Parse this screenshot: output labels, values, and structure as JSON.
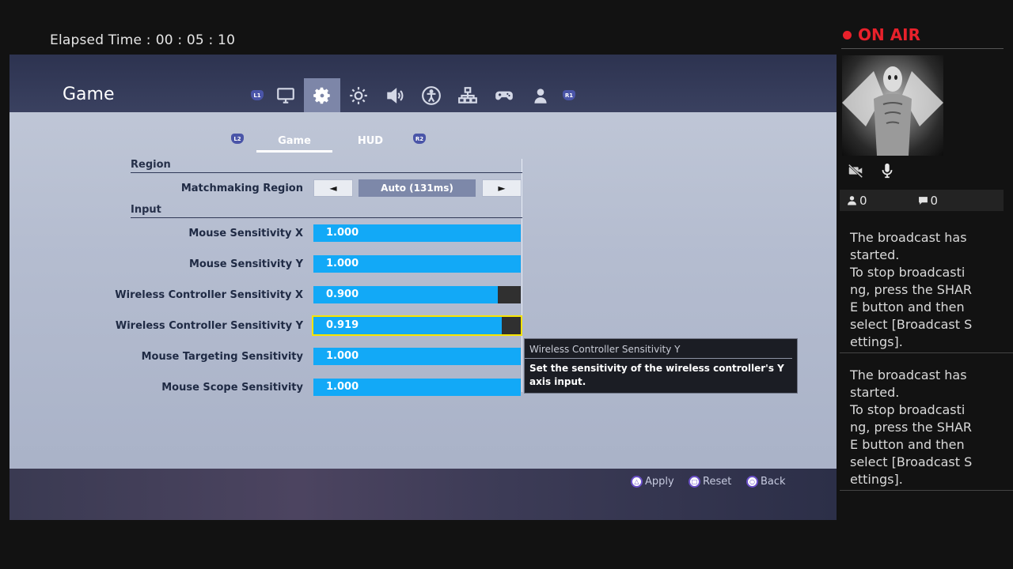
{
  "stream": {
    "elapsed_label": "Elapsed Time :",
    "elapsed_value": "00 : 05 : 10",
    "on_air": "ON AIR",
    "viewers": "0",
    "comments": "0",
    "messages": [
      "The broadcast has started.\nTo stop broadcasti ng, press the SHAR E button and then select [Broadcast S ettings].",
      "The broadcast has started.\nTo stop broadcasti ng, press the SHAR E button and then select [Broadcast S ettings]."
    ]
  },
  "game": {
    "title": "Game",
    "shoulder_left": "L1",
    "shoulder_right": "R1",
    "tab_icons": [
      "monitor-icon",
      "gear-icon",
      "brightness-icon",
      "audio-icon",
      "accessibility-icon",
      "network-icon",
      "controller-icon",
      "account-icon"
    ],
    "active_tab": "gear-icon",
    "subtabs": {
      "left_trigger": "L2",
      "right_trigger": "R2",
      "items": [
        "Game",
        "HUD"
      ],
      "active": "Game"
    },
    "sections": {
      "region": "Region",
      "input": "Input"
    },
    "matchmaking": {
      "label": "Matchmaking Region",
      "value": "Auto (131ms)",
      "prev": "◄",
      "next": "►"
    },
    "sliders": [
      {
        "label": "Mouse Sensitivity X",
        "value": "1.000",
        "fraction": 1.0
      },
      {
        "label": "Mouse Sensitivity Y",
        "value": "1.000",
        "fraction": 1.0
      },
      {
        "label": "Wireless Controller Sensitivity X",
        "value": "0.900",
        "fraction": 0.89
      },
      {
        "label": "Wireless Controller Sensitivity Y",
        "value": "0.919",
        "fraction": 0.91
      },
      {
        "label": "Mouse Targeting Sensitivity",
        "value": "1.000",
        "fraction": 1.0
      },
      {
        "label": "Mouse Scope Sensitivity",
        "value": "1.000",
        "fraction": 1.0
      }
    ],
    "tooltip": {
      "title": "Wireless Controller Sensitivity Y",
      "body": "Set the sensitivity of the wireless controller's Y axis input."
    },
    "hints": {
      "apply": "Apply",
      "reset": "Reset",
      "back": "Back"
    },
    "colors": {
      "slider_fill": "#12a9f7",
      "focus_outline": "#f7e400",
      "on_air": "#e8212b"
    }
  }
}
